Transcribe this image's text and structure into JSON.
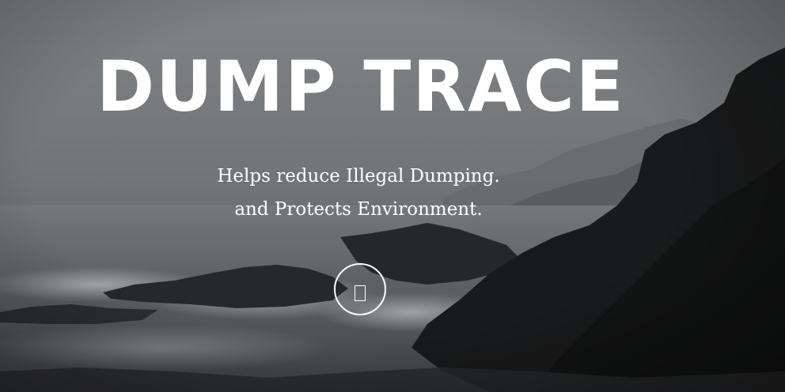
{
  "hero": {
    "title": "DUMP TRACE",
    "tagline_line1": "Helps reduce Illegal Dumping.",
    "tagline_line2": "and Protects Environment.",
    "scroll_icon": "scroll-down-icon"
  },
  "colors": {
    "text": "#ffffff",
    "sky": "#8a8d90",
    "rock": "#1f2021"
  }
}
